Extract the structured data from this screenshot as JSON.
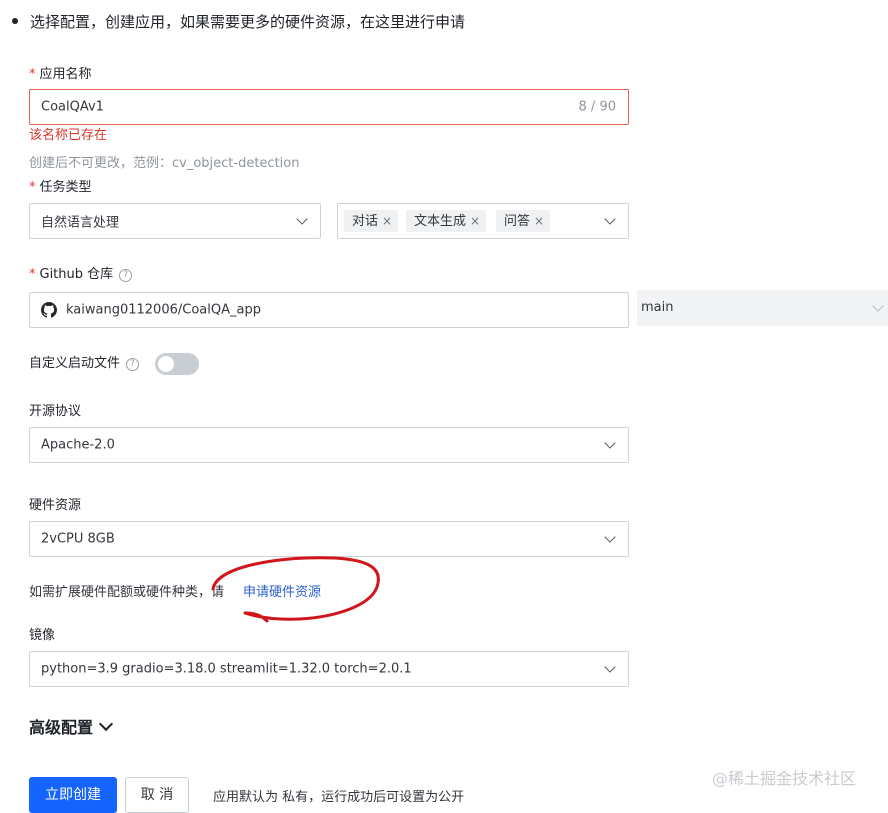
{
  "intro_text": "选择配置，创建应用，如果需要更多的硬件资源，在这里进行申请",
  "app_name": {
    "required_mark": "*",
    "label": "应用名称",
    "value": "CoalQAv1",
    "counter": "8 / 90",
    "error": "该名称已存在",
    "hint": "创建后不可更改，范例：cv_object-detection"
  },
  "task_type": {
    "required_mark": "*",
    "label": "任务类型",
    "category_value": "自然语言处理",
    "tags": [
      {
        "label": "对话",
        "remove": "×"
      },
      {
        "label": "文本生成",
        "remove": "×"
      },
      {
        "label": "问答",
        "remove": "×"
      }
    ]
  },
  "github": {
    "required_mark": "*",
    "label": "Github 仓库",
    "help_glyph": "?",
    "repo_value": "kaiwang0112006/CoalQA_app",
    "branch_value": "main"
  },
  "custom_start": {
    "label": "自定义启动文件",
    "help_glyph": "?",
    "enabled": false
  },
  "license": {
    "label": "开源协议",
    "value": "Apache-2.0"
  },
  "hardware": {
    "label": "硬件资源",
    "value": "2vCPU 8GB",
    "extend_text": "如需扩展硬件配额或硬件种类，请",
    "apply_link": "申请硬件资源"
  },
  "image": {
    "label": "镜像",
    "value": "python=3.9 gradio=3.18.0 streamlit=1.32.0 torch=2.0.1"
  },
  "advanced": {
    "label": "高级配置"
  },
  "actions": {
    "create": "立即创建",
    "cancel": "取 消",
    "note": "应用默认为 私有，运行成功后可设置为公开"
  },
  "watermark": "@稀土掘金技术社区",
  "annotation_color": "#d0161b"
}
